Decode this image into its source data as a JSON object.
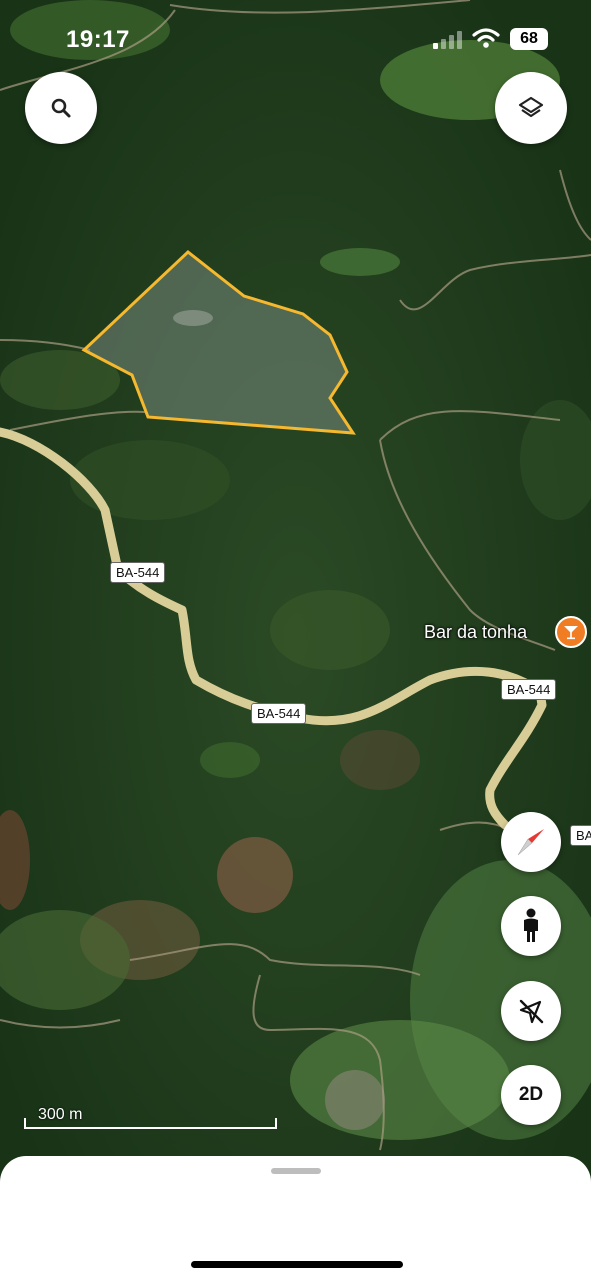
{
  "status_bar": {
    "time": "19:17",
    "battery": "68"
  },
  "map": {
    "roads": [
      {
        "label": "BA-544"
      },
      {
        "label": "BA-544"
      },
      {
        "label": "BA-544"
      },
      {
        "label": "BA"
      }
    ],
    "poi": {
      "name": "Bar da tonha",
      "icon": "cocktail-icon",
      "color": "#f07d24"
    },
    "parcel_outline_color": "#f5b82e",
    "scale": "300 m"
  },
  "controls": {
    "search": "search-icon",
    "layers": "layers-icon",
    "compass": "compass-icon",
    "street_view": "person-icon",
    "location": "location-off-icon",
    "view_mode": "2D"
  }
}
